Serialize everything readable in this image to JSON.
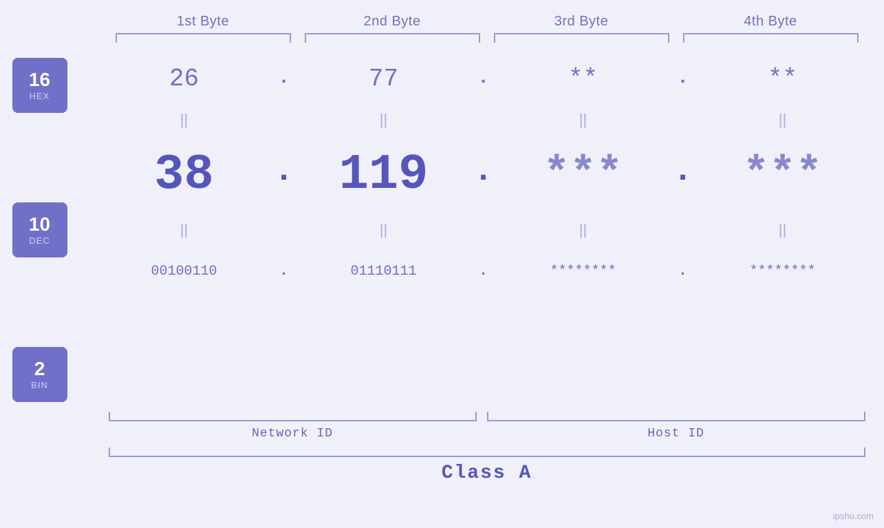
{
  "header": {
    "byte1": "1st Byte",
    "byte2": "2nd Byte",
    "byte3": "3rd Byte",
    "byte4": "4th Byte"
  },
  "badges": [
    {
      "number": "16",
      "label": "HEX"
    },
    {
      "number": "10",
      "label": "DEC"
    },
    {
      "number": "2",
      "label": "BIN"
    }
  ],
  "hex_row": {
    "values": [
      "26",
      "77",
      "**",
      "**"
    ],
    "dots": [
      ".",
      ".",
      "."
    ]
  },
  "dec_row": {
    "values": [
      "38",
      "119.",
      "***.",
      "***"
    ],
    "dots": [
      ".",
      ".",
      "."
    ]
  },
  "bin_row": {
    "values": [
      "00100110",
      "01110111",
      "********",
      "********"
    ],
    "dots": [
      ".",
      ".",
      "."
    ]
  },
  "equals": [
    "||",
    "||",
    "||",
    "||"
  ],
  "labels": {
    "network_id": "Network ID",
    "host_id": "Host ID",
    "class": "Class A"
  },
  "watermark": "ipshu.com"
}
